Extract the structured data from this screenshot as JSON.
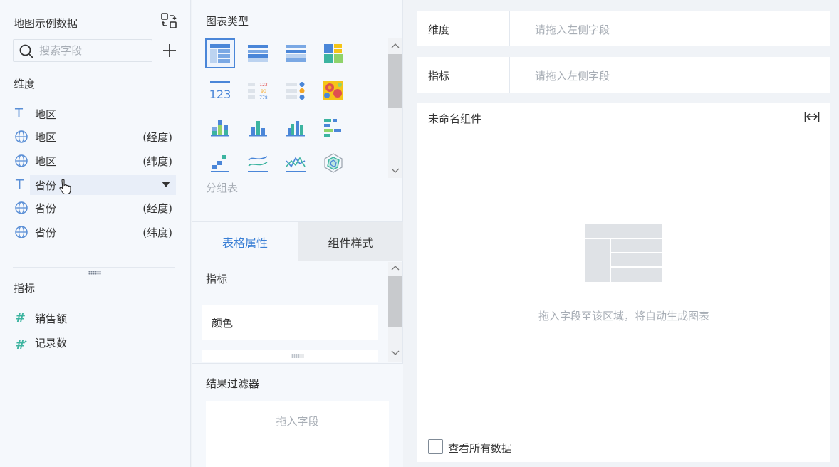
{
  "left_panel": {
    "title": "地图示例数据",
    "search_placeholder": "搜索字段",
    "dimension_label": "维度",
    "dimensions": [
      {
        "type": "text",
        "name": "地区",
        "suffix": ""
      },
      {
        "type": "geo",
        "name": "地区",
        "suffix": "(经度)"
      },
      {
        "type": "geo",
        "name": "地区",
        "suffix": "(纬度)"
      },
      {
        "type": "text",
        "name": "省份",
        "suffix": ""
      },
      {
        "type": "geo",
        "name": "省份",
        "suffix": "(经度)"
      },
      {
        "type": "geo",
        "name": "省份",
        "suffix": "(纬度)"
      }
    ],
    "metric_label": "指标",
    "metrics": [
      {
        "type": "number",
        "name": "销售额"
      },
      {
        "type": "record",
        "name": "记录数"
      }
    ]
  },
  "middle_panel": {
    "chart_type_heading": "图表类型",
    "chart_types": [
      "grouped-table-icon",
      "detail-table-icon",
      "cross-table-icon",
      "color-block-icon",
      "kpi-number-icon",
      "kpi-card-icon",
      "kpi-list-icon",
      "heatmap-icon",
      "stacked-column-icon",
      "column-icon",
      "multi-column-icon",
      "horizontal-bar-icon",
      "scatter-icon",
      "line-icon",
      "zigzag-line-icon",
      "radar-icon"
    ],
    "chart_type_caption": "分组表",
    "tabs": {
      "table_props": "表格属性",
      "widget_style": "组件样式"
    },
    "prop_section_label": "指标",
    "prop_card_label": "颜色",
    "filter_title": "结果过滤器",
    "filter_placeholder": "拖入字段"
  },
  "right_panel": {
    "dimension_row": {
      "label": "维度",
      "placeholder": "请拖入左侧字段"
    },
    "metric_row": {
      "label": "指标",
      "placeholder": "请拖入左侧字段"
    },
    "widget_title": "未命名组件",
    "empty_hint": "拖入字段至该区域，将自动生成图表",
    "view_all_label": "查看所有数据"
  },
  "colors": {
    "accent": "#3a7fd5",
    "teal": "#3cb4a0",
    "panel_bg": "#f5f8fc",
    "placeholder_text": "#a7adb5"
  }
}
